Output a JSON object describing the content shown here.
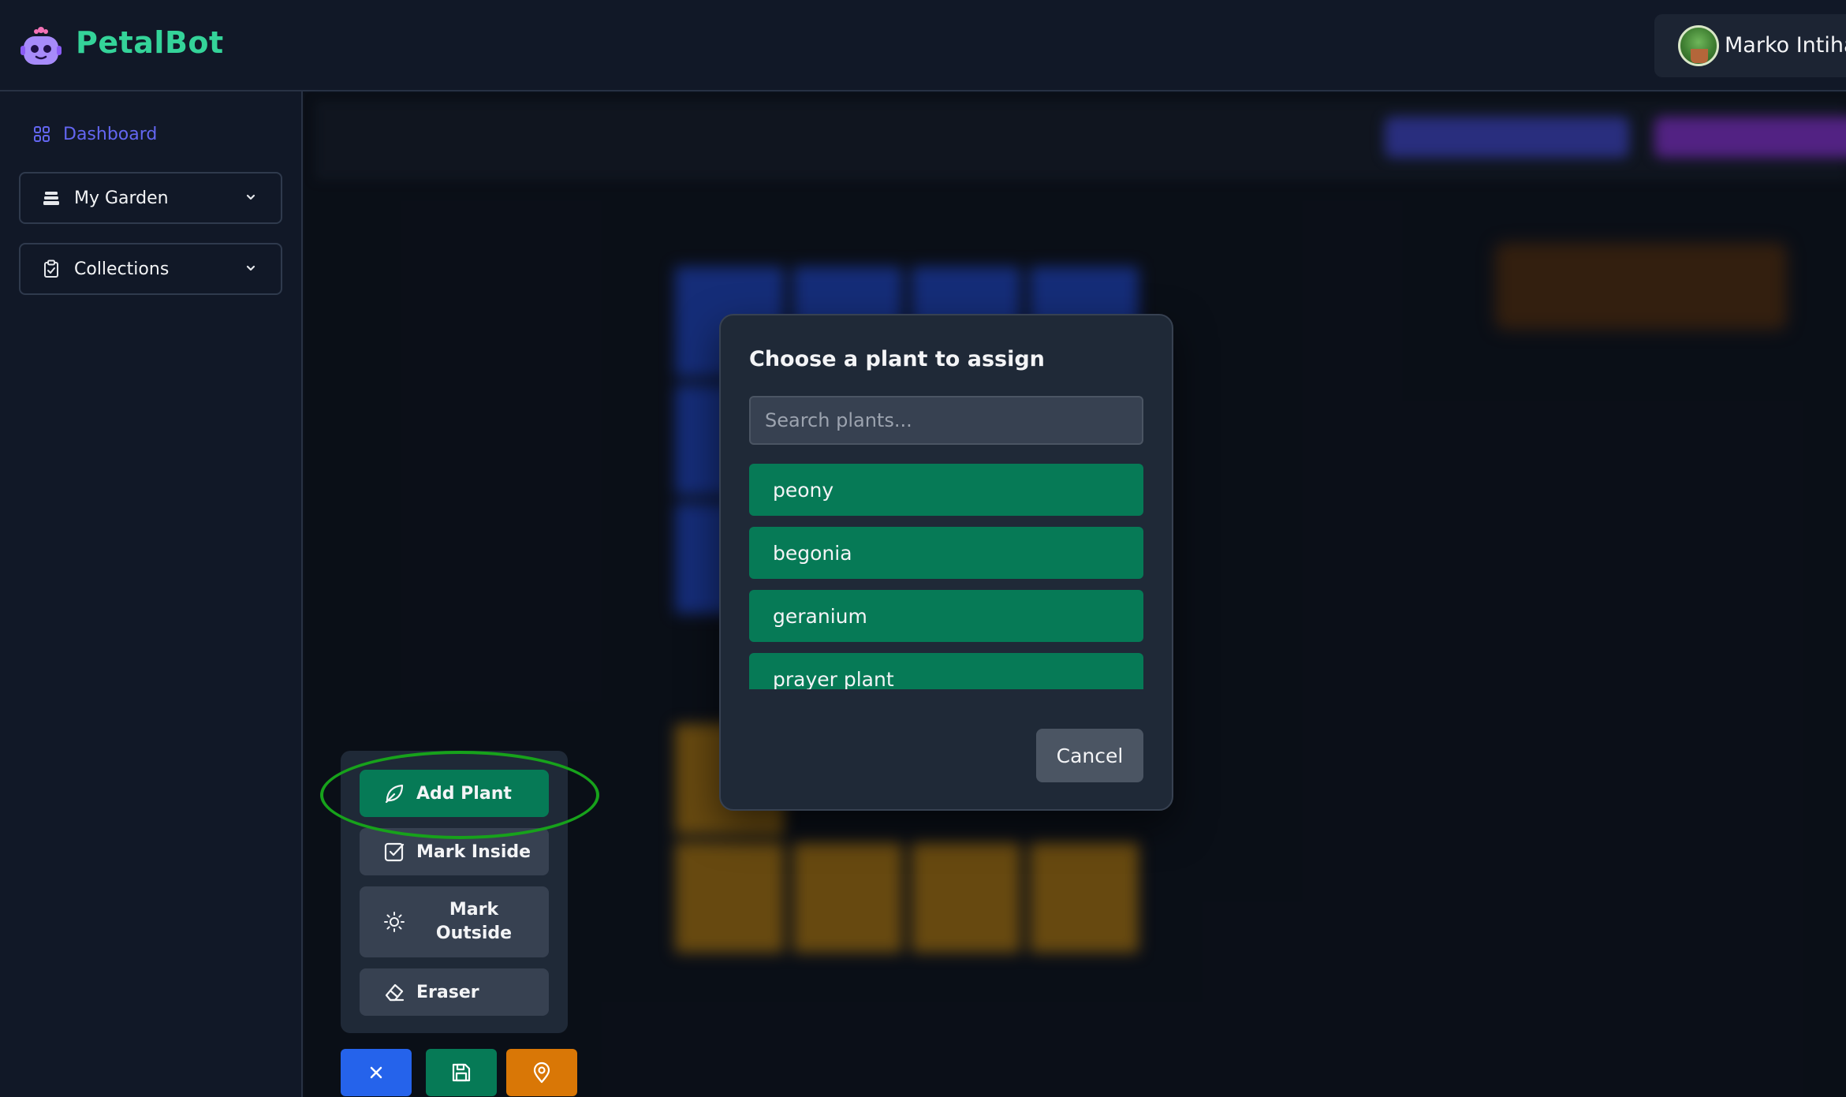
{
  "header": {
    "brand": "PetalBot",
    "user_name": "Marko Intihar"
  },
  "sidebar": {
    "dashboard_label": "Dashboard",
    "items": [
      {
        "label": "My Garden",
        "icon": "layers-icon"
      },
      {
        "label": "Collections",
        "icon": "clipboard-check-icon"
      }
    ]
  },
  "modal": {
    "title": "Choose a plant to assign",
    "search_placeholder": "Search plants...",
    "plants": [
      "peony",
      "begonia",
      "geranium",
      "prayer plant"
    ],
    "cancel_label": "Cancel"
  },
  "tools": {
    "add_plant": "Add Plant",
    "mark_inside": "Mark Inside",
    "mark_outside_line1": "Mark",
    "mark_outside_line2": "Outside",
    "eraser": "Eraser"
  },
  "bottom_actions": [
    {
      "icon": "close-icon",
      "color": "#2563eb"
    },
    {
      "icon": "save-icon",
      "color": "#067a56"
    },
    {
      "icon": "map-pin-icon",
      "color": "#d97706"
    }
  ],
  "colors": {
    "brand": "#34d399",
    "accent": "#6366f1",
    "plant_button": "#067a56",
    "highlight_ring": "#17a21b"
  }
}
